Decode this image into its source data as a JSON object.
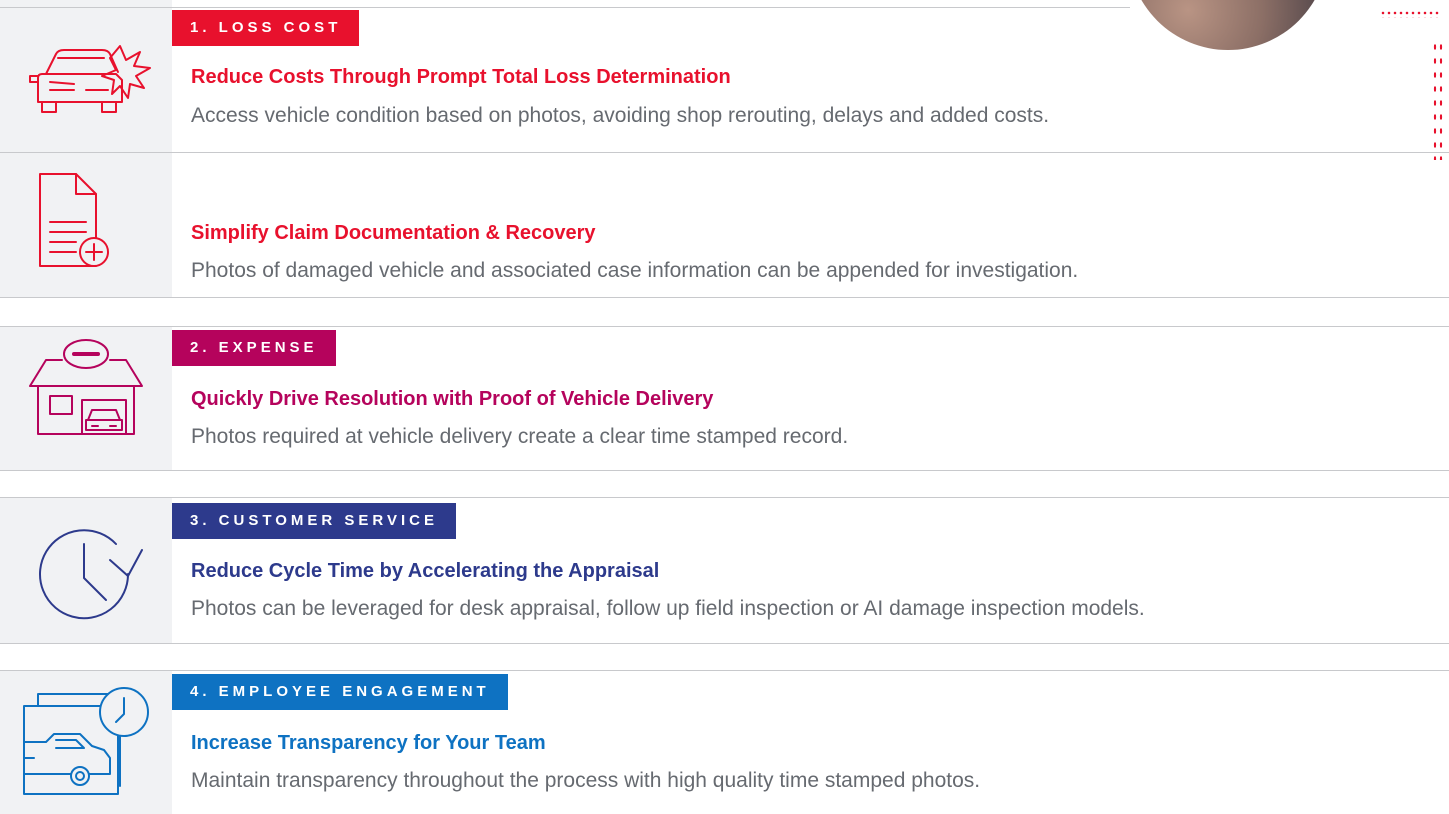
{
  "colors": {
    "loss_cost": "#e8112d",
    "expense": "#b5035c",
    "customer_service": "#2d3a8c",
    "employee_engagement": "#0e72c2",
    "description": "#666a70",
    "row_bg": "#f1f2f4",
    "divider": "#c8c9cc"
  },
  "sections": [
    {
      "tag": "1. LOSS COST",
      "items": [
        {
          "icon": "car-crash-icon",
          "heading": "Reduce Costs Through Prompt Total Loss Determination",
          "description": "Access vehicle condition based on photos, avoiding shop rerouting, delays and added costs."
        },
        {
          "icon": "document-add-icon",
          "heading": "Simplify Claim Documentation & Recovery",
          "description": "Photos of damaged vehicle and associated case information can be appended for investigation."
        }
      ]
    },
    {
      "tag": "2. EXPENSE",
      "items": [
        {
          "icon": "garage-icon",
          "heading": "Quickly Drive Resolution with Proof of Vehicle Delivery",
          "description": "Photos required at vehicle delivery create a clear time stamped record."
        }
      ]
    },
    {
      "tag": "3. CUSTOMER SERVICE",
      "items": [
        {
          "icon": "clock-refresh-icon",
          "heading": "Reduce Cycle Time by Accelerating the Appraisal",
          "description": "Photos can be leveraged for desk appraisal, follow up field inspection or AI damage inspection models."
        }
      ]
    },
    {
      "tag": "4. EMPLOYEE ENGAGEMENT",
      "items": [
        {
          "icon": "car-photo-clock-icon",
          "heading": "Increase Transparency for Your Team",
          "description": "Maintain transparency throughout the process with high quality time stamped photos."
        }
      ]
    }
  ]
}
